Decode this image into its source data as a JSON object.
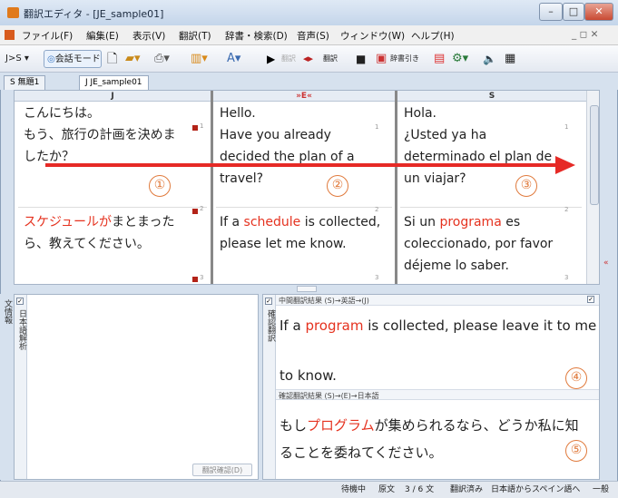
{
  "window": {
    "title": "翻訳エディタ - [JE_sample01]",
    "min": "–",
    "max": "□",
    "close": "✕"
  },
  "menu": [
    "ファイル(F)",
    "編集(E)",
    "表示(V)",
    "翻訳(T)",
    "辞書・検索(D)",
    "音声(S)",
    "ウィンドウ(W)",
    "ヘルプ(H)"
  ],
  "menu_right": "_ ◻ ✕",
  "toolbar": {
    "lang": "J>S ▾",
    "mode": "会話モード",
    "translate1": "翻訳",
    "translate2": "翻訳",
    "dict": "辞書引き"
  },
  "tabs": [
    "S 無題1",
    "J JE_sample01"
  ],
  "grid": {
    "headers": [
      "J",
      "»E«",
      "S"
    ],
    "col_j": {
      "s1": "こんにちは。",
      "s2a": "もう、旅行の計画を決めま",
      "s2b": "したか？",
      "s3_red": "スケジュールが",
      "s3a": "まとまった",
      "s3b": "ら、教えてください。"
    },
    "col_e": {
      "s1": "Hello.",
      "s2a": "Have you already",
      "s2b": "decided the plan of a",
      "s2c": "travel?",
      "s3a_pre": "If a ",
      "s3a_red": "schedule",
      "s3a_post": " is collected,",
      "s3b": "please let me know."
    },
    "col_s": {
      "s1": "Hola.",
      "s2a": "¿Usted ya ha",
      "s2b": "determinado el plan de",
      "s2c": "un viajar?",
      "s3a_pre": "Si un ",
      "s3a_red": "programa",
      "s3a_post": " es",
      "s3b": "coleccionado, por favor",
      "s3c": "déjeme lo saber."
    },
    "marks": [
      "1",
      "2",
      "3"
    ],
    "circles": [
      "①",
      "②",
      "③"
    ]
  },
  "lower_left": {
    "label_side": "文情報",
    "label_check": "日本語解析",
    "button": "翻訳確認(D)"
  },
  "lower_right": {
    "side_label": "確認翻訳",
    "sec1_head": "中間翻訳結果 (S)→英語→(J)",
    "sec1_pre": "If a ",
    "sec1_red": "program",
    "sec1_post": " is collected, please leave it to me",
    "sec1_line2": "to know.",
    "circle4": "④",
    "sec2_head": "確認翻訳結果 (S)→(E)→日本語",
    "sec2_pre": "もし",
    "sec2_red": "プログラム",
    "sec2_post": "が集められるなら、どうか私に知",
    "sec2_line2": "ることを委ねてください。",
    "circle5": "⑤"
  },
  "status": {
    "state": "待機中",
    "kind": "原文",
    "count": "3 / 6 文",
    "done": "翻訳済み",
    "direction": "日本語からスペイン語へ",
    "mode": "一般"
  },
  "colors": {
    "accent_red": "#e5321f",
    "circle": "#e07a3c"
  }
}
